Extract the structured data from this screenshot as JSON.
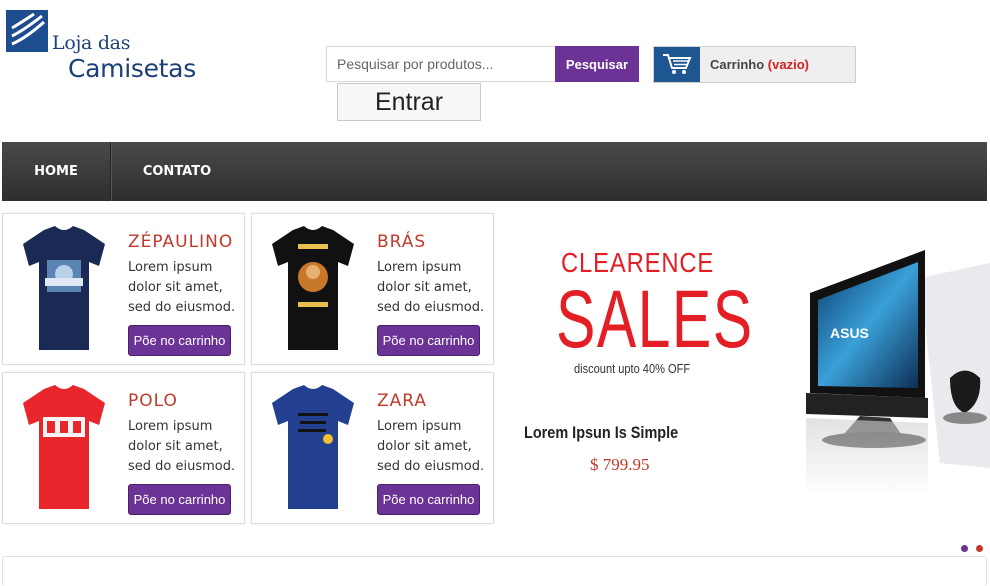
{
  "header": {
    "logo_line1": "Loja das",
    "logo_line2": "Camisetas",
    "search_placeholder": "Pesquisar por produtos...",
    "search_button": "Pesquisar",
    "cart_label": "Carrinho",
    "cart_status": "(vazio)",
    "login_button": "Entrar"
  },
  "nav": {
    "items": [
      "HOME",
      "CONTATO"
    ]
  },
  "products": [
    {
      "name": "ZÉPAULINO",
      "line1": "Lorem ipsum",
      "line2": "dolor sit amet,",
      "line3": "sed do eiusmod.",
      "button": "Põe no carrinho",
      "shirt_color": "#1b2a55"
    },
    {
      "name": "BRÁS",
      "line1": "Lorem ipsum",
      "line2": "dolor sit amet,",
      "line3": "sed do eiusmod.",
      "button": "Põe no carrinho",
      "shirt_color": "#111111"
    },
    {
      "name": "POLO",
      "line1": "Lorem ipsum",
      "line2": "dolor sit amet,",
      "line3": "sed do eiusmod.",
      "button": "Põe no carrinho",
      "shirt_color": "#e8262b"
    },
    {
      "name": "ZARA",
      "line1": "Lorem ipsum",
      "line2": "dolor sit amet,",
      "line3": "sed do eiusmod.",
      "button": "Põe no carrinho",
      "shirt_color": "#233f8f"
    }
  ],
  "banner": {
    "headline1": "CLEARENCE",
    "headline2": "SALES",
    "discount": "discount upto 40% OFF",
    "title": "Lorem Ipsun Is Simple",
    "price": "$ 799.95",
    "monitor_brand": "ASUS"
  },
  "colors": {
    "accent_purple": "#6c3396",
    "price_red": "#c0392b",
    "cart_blue": "#1e5692",
    "nav_dark": "#3a3a3a"
  }
}
